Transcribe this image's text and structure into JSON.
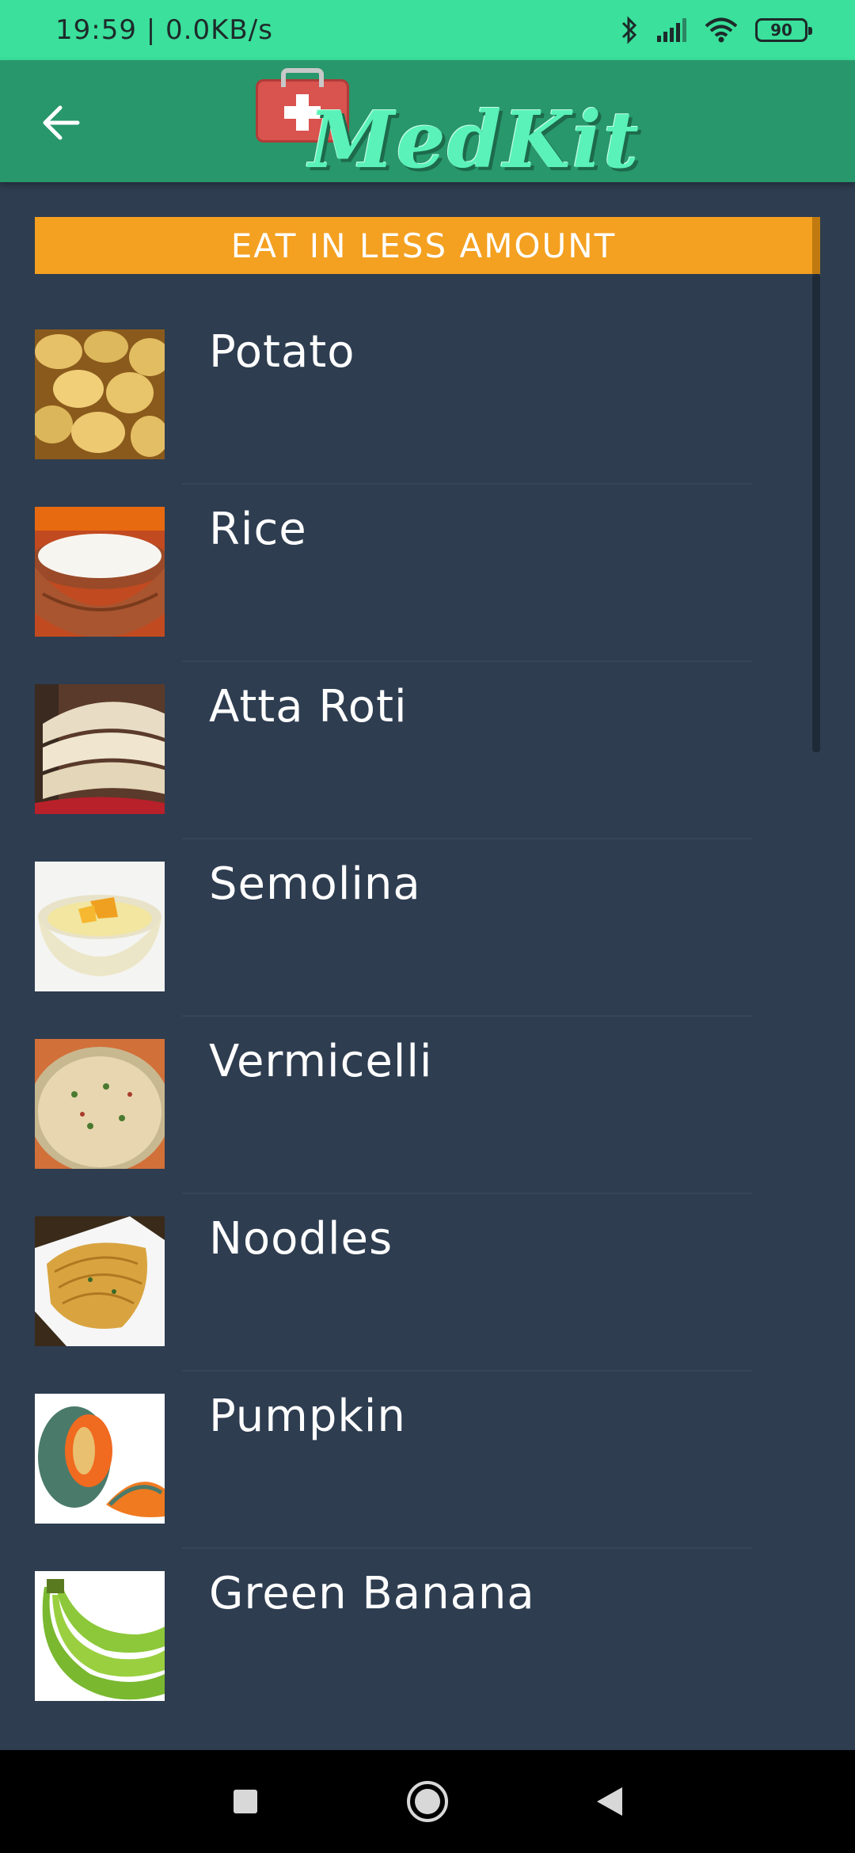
{
  "status_bar": {
    "time_speed": "19:59 | 0.0KB/s",
    "battery": "90",
    "icons": [
      "bluetooth-icon",
      "signal-icon",
      "wifi-icon",
      "battery-icon"
    ]
  },
  "app_bar": {
    "logo_text": "MedKit",
    "back_icon": "arrow-left-icon"
  },
  "section": {
    "title": "EAT IN LESS AMOUNT"
  },
  "foods": [
    {
      "name": "Potato",
      "thumb": "potato"
    },
    {
      "name": "Rice",
      "thumb": "rice"
    },
    {
      "name": "Atta Roti",
      "thumb": "roti"
    },
    {
      "name": "Semolina",
      "thumb": "semolina"
    },
    {
      "name": "Vermicelli",
      "thumb": "vermicelli"
    },
    {
      "name": "Noodles",
      "thumb": "noodles"
    },
    {
      "name": "Pumpkin",
      "thumb": "pumpkin"
    },
    {
      "name": "Green Banana",
      "thumb": "banana"
    }
  ],
  "colors": {
    "status_bar": "#3ae09b",
    "app_bar": "#28976b",
    "background": "#2e3d50",
    "section_header": "#f4a020"
  },
  "nav_bar": {
    "icons": [
      "recent-apps-icon",
      "home-icon",
      "back-icon"
    ]
  }
}
